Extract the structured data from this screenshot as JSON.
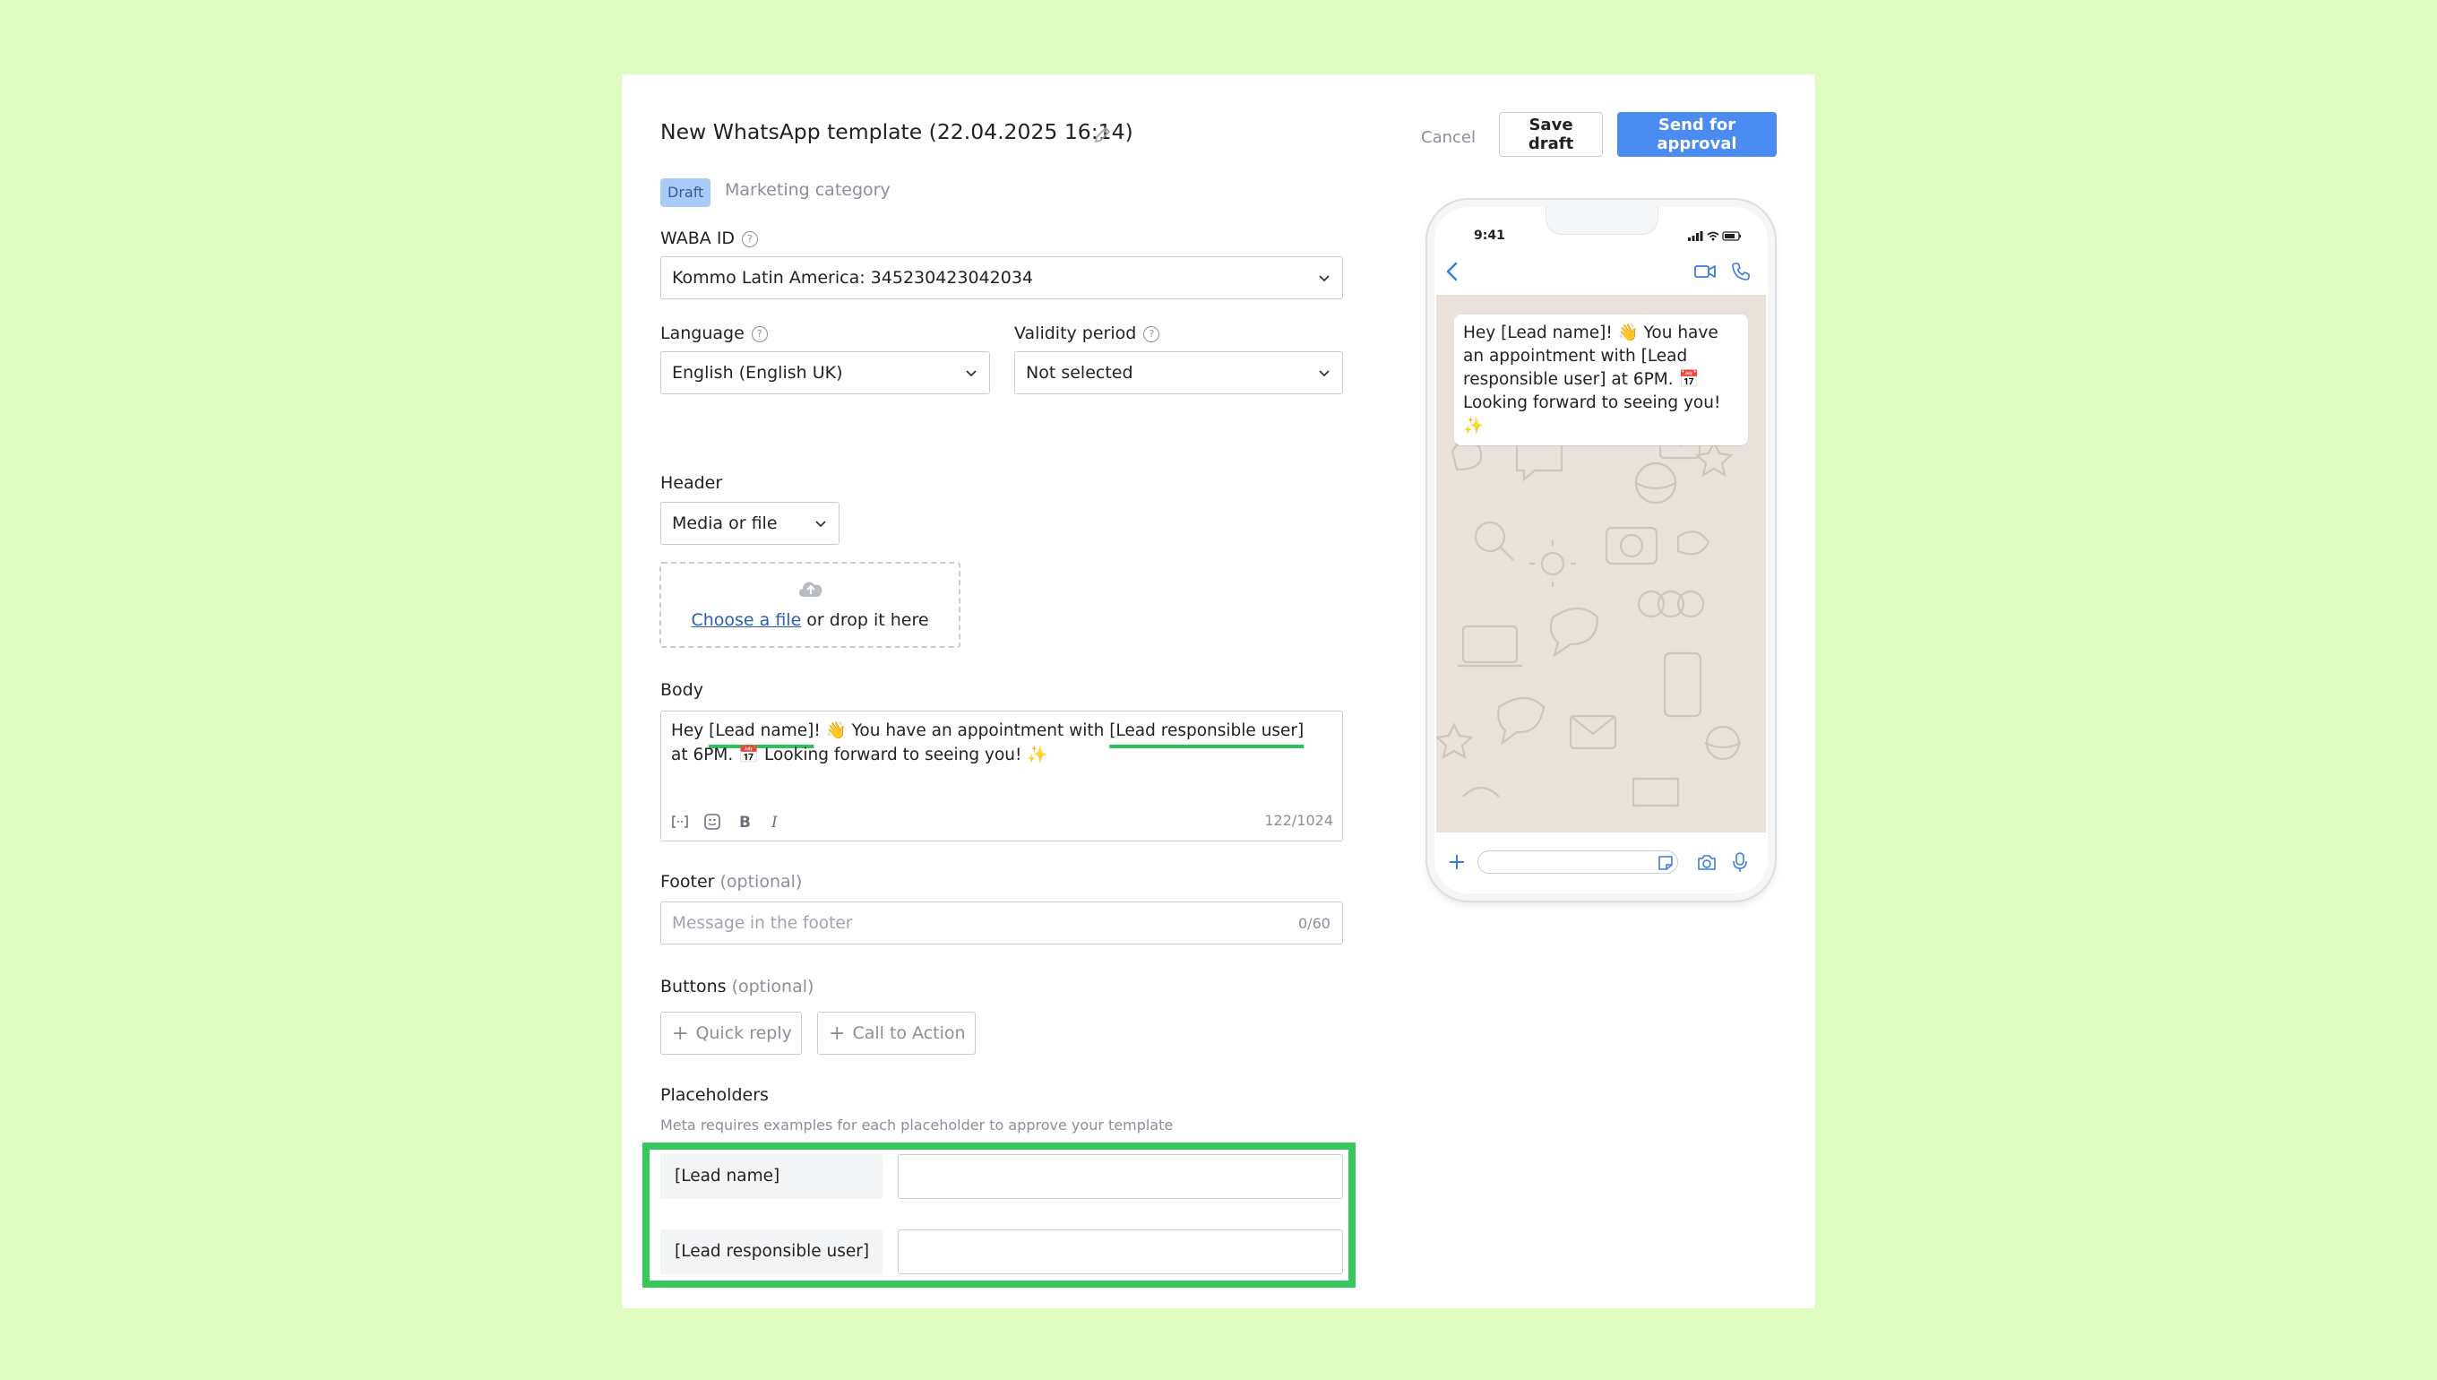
{
  "header": {
    "title": "New WhatsApp template (22.04.2025 16:14)",
    "cancel_label": "Cancel",
    "save_draft_label": "Save draft",
    "send_label": "Send for approval",
    "status_badge": "Draft",
    "category": "Marketing category"
  },
  "waba": {
    "label": "WABA ID",
    "value": "Kommo Latin America: 345230423042034"
  },
  "language": {
    "label": "Language",
    "value": "English (English UK)"
  },
  "validity": {
    "label": "Validity period",
    "value": "Not selected"
  },
  "header_section": {
    "label": "Header",
    "type_value": "Media or file",
    "choose_file_link": "Choose a file",
    "drop_text": " or drop it here"
  },
  "body": {
    "label": "Body",
    "text_parts": [
      "Hey ",
      "[Lead name]",
      "! 👋 You have an appointment with ",
      "[Lead responsible user]",
      " at 6PM. 📅 Looking forward to seeing you! ✨"
    ],
    "counter": "122/1024"
  },
  "footer": {
    "label": "Footer",
    "optional": " (optional)",
    "placeholder": "Message in the footer",
    "counter": "0/60"
  },
  "buttons": {
    "label": "Buttons",
    "optional": " (optional)",
    "quick_reply": "Quick reply",
    "call_to_action": "Call to Action"
  },
  "placeholders": {
    "label": "Placeholders",
    "description": "Meta requires examples for each placeholder to approve your template",
    "items": [
      {
        "name": "[Lead name]",
        "value": ""
      },
      {
        "name": "[Lead responsible user]",
        "value": ""
      }
    ]
  },
  "preview": {
    "time": "9:41",
    "message": "Hey [Lead name]! 👋 You have an appointment with [Lead responsible user] at 6PM. 📅 Looking forward to seeing you! ✨"
  },
  "colors": {
    "background": "#e0fcbf",
    "primary": "#4a8cf2",
    "highlight": "#36c85c",
    "badge": "#a9cbf7",
    "link": "#2b5fb7",
    "whatsapp_icons": "#3a7be0"
  }
}
